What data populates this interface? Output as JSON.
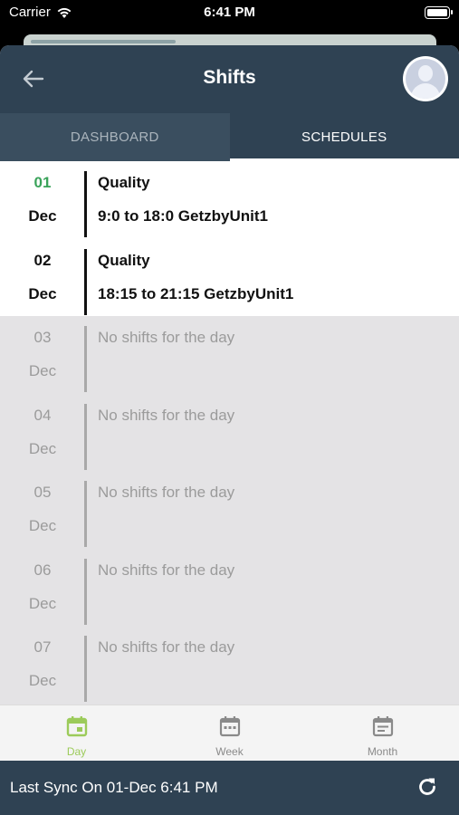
{
  "status_bar": {
    "carrier": "Carrier",
    "time": "6:41 PM"
  },
  "nav": {
    "title": "Shifts",
    "back_icon": "arrow-left-icon",
    "avatar_icon": "user-avatar-icon"
  },
  "tabs": [
    {
      "label": "DASHBOARD",
      "active": false
    },
    {
      "label": "SCHEDULES",
      "active": true
    }
  ],
  "days": [
    {
      "day": "01",
      "month": "Dec",
      "title": "Quality",
      "detail": "9:0 to 18:0 GetzbyUnit1",
      "today": true
    },
    {
      "day": "02",
      "month": "Dec",
      "title": "Quality",
      "detail": "18:15 to 21:15 GetzbyUnit1",
      "today": false
    },
    {
      "day": "03",
      "month": "Dec",
      "empty_text": "No shifts for the day"
    },
    {
      "day": "04",
      "month": "Dec",
      "empty_text": "No shifts for the day"
    },
    {
      "day": "05",
      "month": "Dec",
      "empty_text": "No shifts for the day"
    },
    {
      "day": "06",
      "month": "Dec",
      "empty_text": "No shifts for the day"
    },
    {
      "day": "07",
      "month": "Dec",
      "empty_text": "No shifts for the day"
    }
  ],
  "bottom_tabs": [
    {
      "label": "Day",
      "icon": "calendar-day-icon",
      "active": true
    },
    {
      "label": "Week",
      "icon": "calendar-week-icon",
      "active": false
    },
    {
      "label": "Month",
      "icon": "calendar-month-icon",
      "active": false
    }
  ],
  "sync": {
    "text": "Last Sync On 01-Dec 6:41 PM",
    "refresh_icon": "refresh-icon"
  },
  "colors": {
    "header": "#2f4253",
    "today_green": "#3aa35a",
    "active_tab_green": "#9ccb5a",
    "empty_bg": "#e4e3e5"
  }
}
